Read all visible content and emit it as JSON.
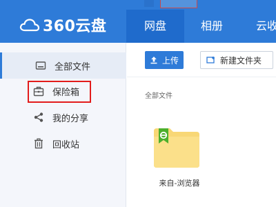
{
  "header": {
    "logo_text": "360云盘",
    "tabs": [
      {
        "label": "网盘",
        "active": true
      },
      {
        "label": "相册",
        "active": false
      },
      {
        "label": "云收",
        "active": false
      }
    ]
  },
  "sidebar": {
    "items": [
      {
        "label": "全部文件",
        "icon": "folder-icon",
        "active": true
      },
      {
        "label": "保险箱",
        "icon": "safe-box-icon",
        "active": false,
        "highlighted": true
      },
      {
        "label": "我的分享",
        "icon": "share-icon",
        "active": false
      },
      {
        "label": "回收站",
        "icon": "trash-icon",
        "active": false
      }
    ]
  },
  "toolbar": {
    "upload_label": "上传",
    "new_folder_label": "新建文件夹"
  },
  "breadcrumb": "全部文件",
  "files": [
    {
      "name": "来自-浏览器",
      "type": "folder",
      "badge_icon": "browser-e-icon"
    }
  ],
  "colors": {
    "header_bg": "#2e7bd8",
    "active_tab_bg": "#1f6bcc",
    "folder_yellow": "#f8d776",
    "badge_green": "#4caf2c",
    "highlight_red": "#e21b1b"
  }
}
